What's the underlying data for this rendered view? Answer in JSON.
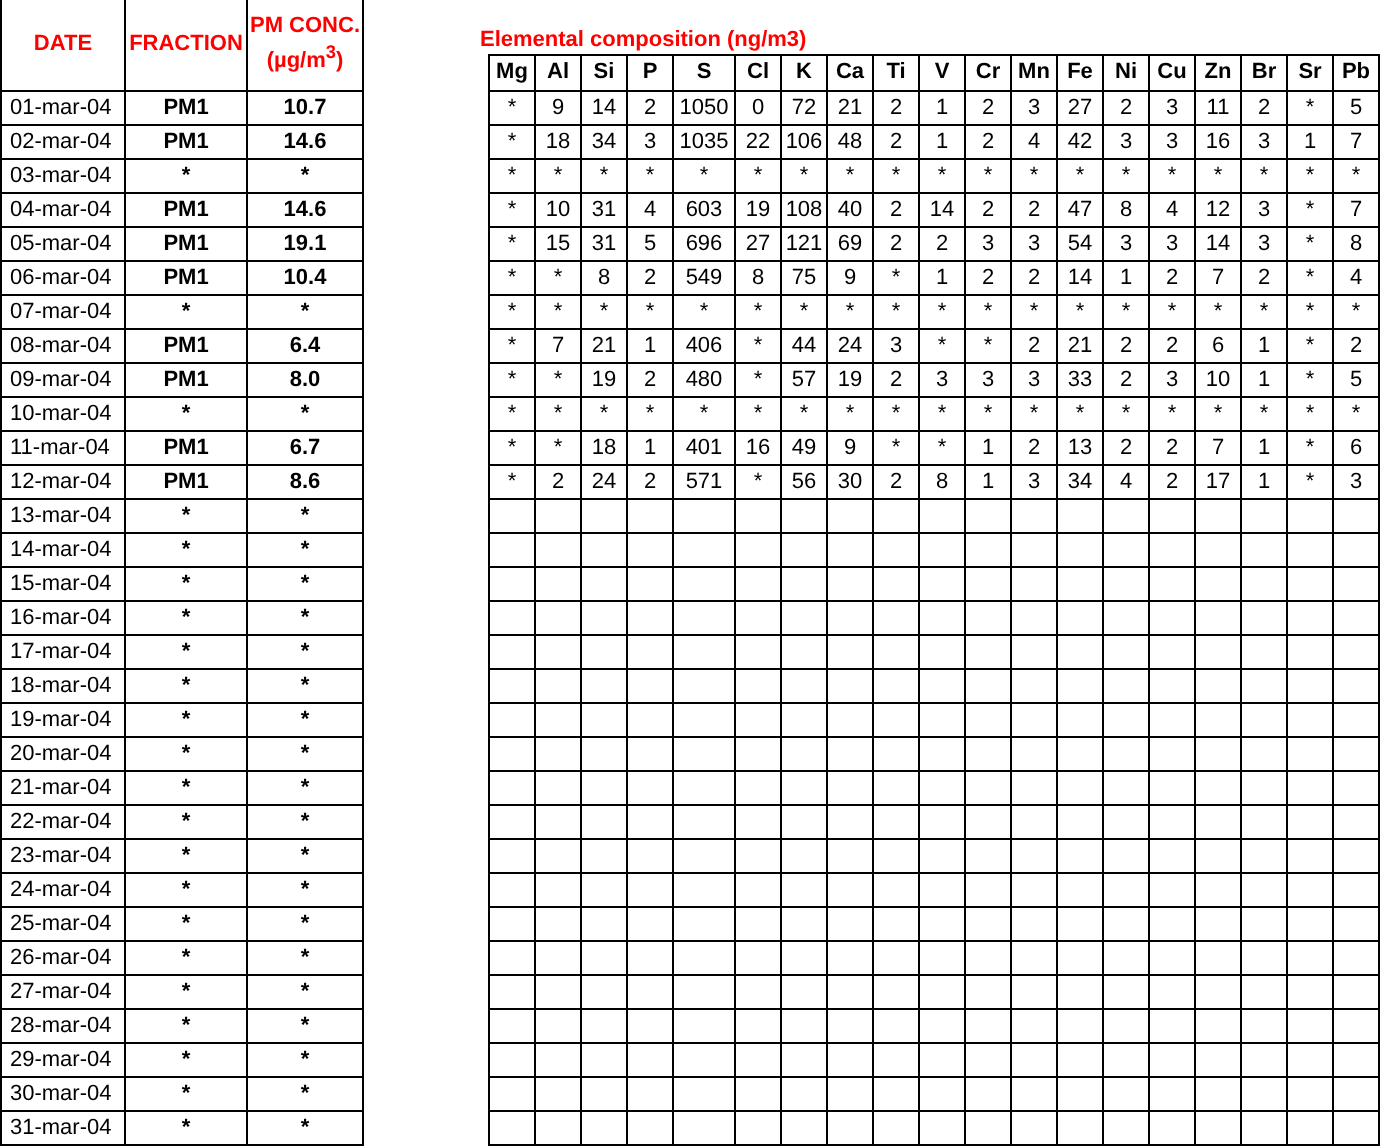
{
  "pm_table": {
    "columns": [
      "DATE",
      "FRACTION",
      "PM CONC. (µg/m$^{3}$)"
    ],
    "rows": [
      [
        "01-mar-04",
        "PM1",
        "10.7"
      ],
      [
        "02-mar-04",
        "PM1",
        "14.6"
      ],
      [
        "03-mar-04",
        "*",
        "*"
      ],
      [
        "04-mar-04",
        "PM1",
        "14.6"
      ],
      [
        "05-mar-04",
        "PM1",
        "19.1"
      ],
      [
        "06-mar-04",
        "PM1",
        "10.4"
      ],
      [
        "07-mar-04",
        "*",
        "*"
      ],
      [
        "08-mar-04",
        "PM1",
        "6.4"
      ],
      [
        "09-mar-04",
        "PM1",
        "8.0"
      ],
      [
        "10-mar-04",
        "*",
        "*"
      ],
      [
        "11-mar-04",
        "PM1",
        "6.7"
      ],
      [
        "12-mar-04",
        "PM1",
        "8.6"
      ],
      [
        "13-mar-04",
        "*",
        "*"
      ],
      [
        "14-mar-04",
        "*",
        "*"
      ],
      [
        "15-mar-04",
        "*",
        "*"
      ],
      [
        "16-mar-04",
        "*",
        "*"
      ],
      [
        "17-mar-04",
        "*",
        "*"
      ],
      [
        "18-mar-04",
        "*",
        "*"
      ],
      [
        "19-mar-04",
        "*",
        "*"
      ],
      [
        "20-mar-04",
        "*",
        "*"
      ],
      [
        "21-mar-04",
        "*",
        "*"
      ],
      [
        "22-mar-04",
        "*",
        "*"
      ],
      [
        "23-mar-04",
        "*",
        "*"
      ],
      [
        "24-mar-04",
        "*",
        "*"
      ],
      [
        "25-mar-04",
        "*",
        "*"
      ],
      [
        "26-mar-04",
        "*",
        "*"
      ],
      [
        "27-mar-04",
        "*",
        "*"
      ],
      [
        "28-mar-04",
        "*",
        "*"
      ],
      [
        "29-mar-04",
        "*",
        "*"
      ],
      [
        "30-mar-04",
        "*",
        "*"
      ],
      [
        "31-mar-04",
        "*",
        "*"
      ]
    ]
  },
  "elemental_table": {
    "title": "Elemental composition (ng/m3)",
    "columns": [
      "Mg",
      "Al",
      "Si",
      "P",
      "S",
      "Cl",
      "K",
      "Ca",
      "Ti",
      "V",
      "Cr",
      "Mn",
      "Fe",
      "Ni",
      "Cu",
      "Zn",
      "Br",
      "Sr",
      "Pb"
    ],
    "rows": [
      [
        "*",
        "9",
        "14",
        "2",
        "1050",
        "0",
        "72",
        "21",
        "2",
        "1",
        "2",
        "3",
        "27",
        "2",
        "3",
        "11",
        "2",
        "*",
        "5"
      ],
      [
        "*",
        "18",
        "34",
        "3",
        "1035",
        "22",
        "106",
        "48",
        "2",
        "1",
        "2",
        "4",
        "42",
        "3",
        "3",
        "16",
        "3",
        "1",
        "7"
      ],
      [
        "*",
        "*",
        "*",
        "*",
        "*",
        "*",
        "*",
        "*",
        "*",
        "*",
        "*",
        "*",
        "*",
        "*",
        "*",
        "*",
        "*",
        "*",
        "*"
      ],
      [
        "*",
        "10",
        "31",
        "4",
        "603",
        "19",
        "108",
        "40",
        "2",
        "14",
        "2",
        "2",
        "47",
        "8",
        "4",
        "12",
        "3",
        "*",
        "7"
      ],
      [
        "*",
        "15",
        "31",
        "5",
        "696",
        "27",
        "121",
        "69",
        "2",
        "2",
        "3",
        "3",
        "54",
        "3",
        "3",
        "14",
        "3",
        "*",
        "8"
      ],
      [
        "*",
        "*",
        "8",
        "2",
        "549",
        "8",
        "75",
        "9",
        "*",
        "1",
        "2",
        "2",
        "14",
        "1",
        "2",
        "7",
        "2",
        "*",
        "4"
      ],
      [
        "*",
        "*",
        "*",
        "*",
        "*",
        "*",
        "*",
        "*",
        "*",
        "*",
        "*",
        "*",
        "*",
        "*",
        "*",
        "*",
        "*",
        "*",
        "*"
      ],
      [
        "*",
        "7",
        "21",
        "1",
        "406",
        "*",
        "44",
        "24",
        "3",
        "*",
        "*",
        "2",
        "21",
        "2",
        "2",
        "6",
        "1",
        "*",
        "2"
      ],
      [
        "*",
        "*",
        "19",
        "2",
        "480",
        "*",
        "57",
        "19",
        "2",
        "3",
        "3",
        "3",
        "33",
        "2",
        "3",
        "10",
        "1",
        "*",
        "5"
      ],
      [
        "*",
        "*",
        "*",
        "*",
        "*",
        "*",
        "*",
        "*",
        "*",
        "*",
        "*",
        "*",
        "*",
        "*",
        "*",
        "*",
        "*",
        "*",
        "*"
      ],
      [
        "*",
        "*",
        "18",
        "1",
        "401",
        "16",
        "49",
        "9",
        "*",
        "*",
        "1",
        "2",
        "13",
        "2",
        "2",
        "7",
        "1",
        "*",
        "6"
      ],
      [
        "*",
        "2",
        "24",
        "2",
        "571",
        "*",
        "56",
        "30",
        "2",
        "8",
        "1",
        "3",
        "34",
        "4",
        "2",
        "17",
        "1",
        "*",
        "3"
      ]
    ]
  }
}
